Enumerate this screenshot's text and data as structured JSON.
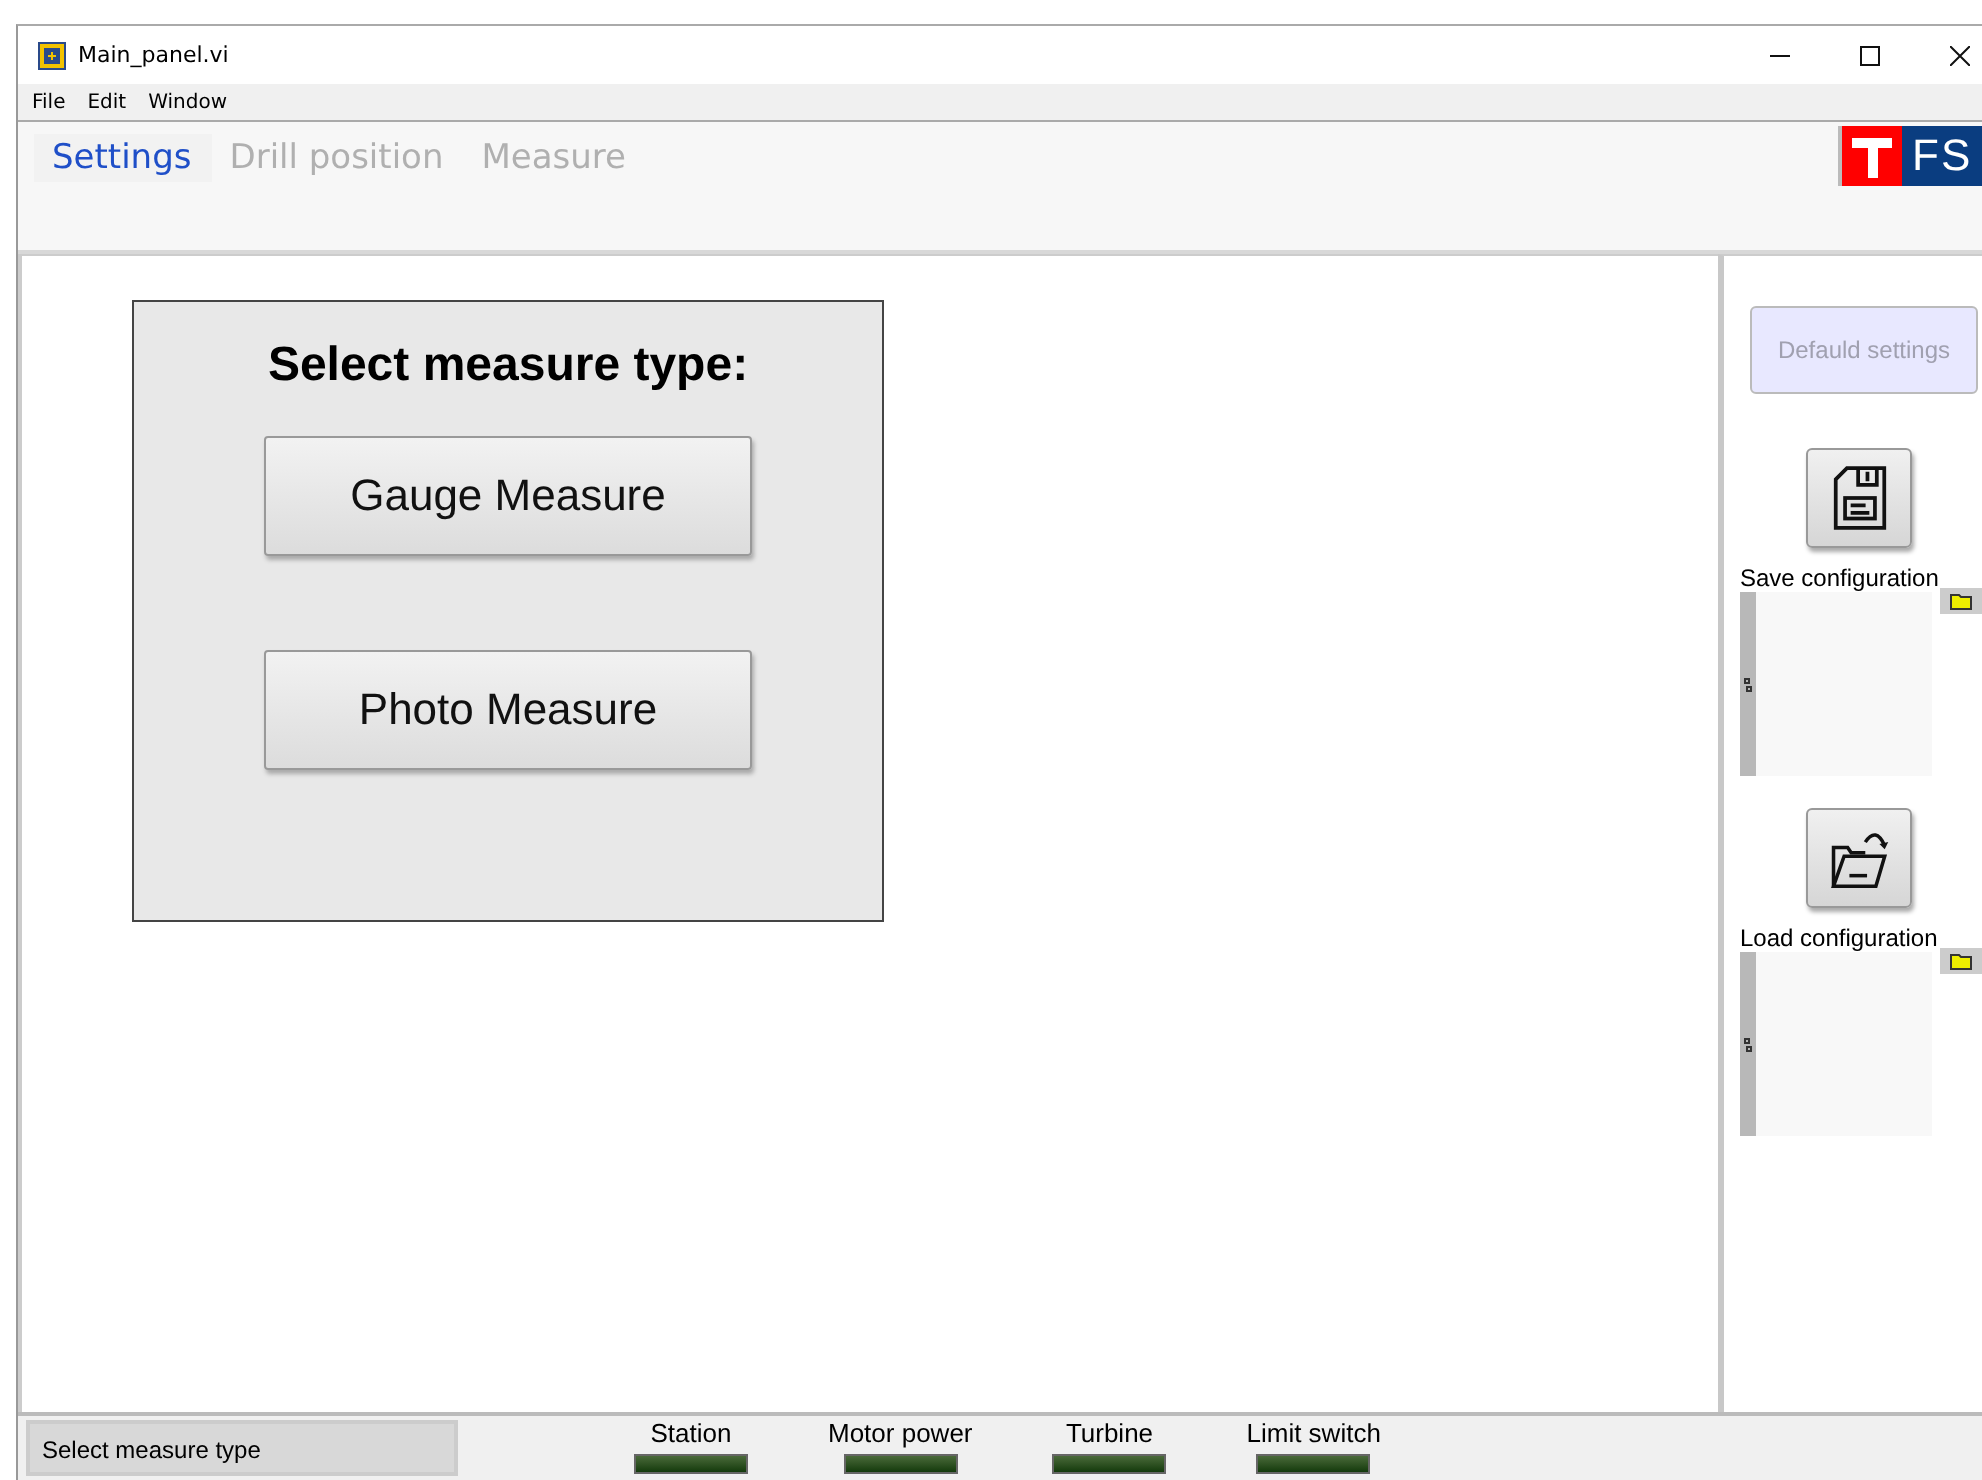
{
  "window": {
    "title": "Main_panel.vi"
  },
  "menu": [
    "File",
    "Edit",
    "Window"
  ],
  "tabs": [
    {
      "label": "Settings",
      "selected": true
    },
    {
      "label": "Drill position",
      "selected": false
    },
    {
      "label": "Measure",
      "selected": false
    }
  ],
  "logo": {
    "text": "FS"
  },
  "measure_panel": {
    "title": "Select measure type:",
    "buttons": [
      "Gauge Measure",
      "Photo Measure"
    ]
  },
  "side_panel": {
    "default_button": {
      "label": "Defauld settings",
      "disabled": true
    },
    "configs": [
      {
        "kind": "save",
        "label": "Save configuration"
      },
      {
        "kind": "load",
        "label": "Load configuration"
      }
    ]
  },
  "status_bar": {
    "message": "Select measure type",
    "indicators": [
      {
        "label": "Station",
        "on": false
      },
      {
        "label": "Motor power",
        "on": false
      },
      {
        "label": "Turbine",
        "on": false
      },
      {
        "label": "Limit switch",
        "on": false
      }
    ]
  }
}
